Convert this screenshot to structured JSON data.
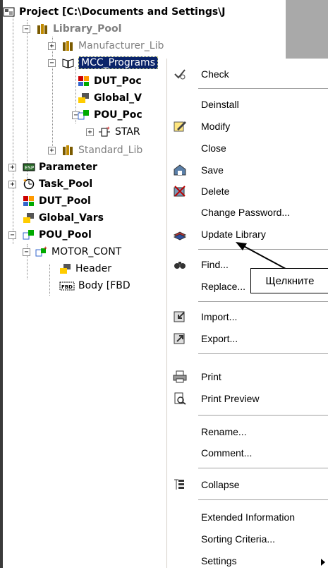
{
  "tree": {
    "project": "Project [C:\\Documents and Settings\\J",
    "library_pool": "Library_Pool",
    "manufacturer_lib": "Manufacturer_Lib",
    "mcc_programs": "MCC_Programs",
    "dut_pool_sub": "DUT_Poc",
    "global_vars_sub": "Global_V",
    "pou_pool_sub": "POU_Poc",
    "star_item": "STAR",
    "standard_lib": "Standard_Lib",
    "parameter": "Parameter",
    "task_pool": "Task_Pool",
    "dut_pool": "DUT_Pool",
    "global_vars": "Global_Vars",
    "pou_pool": "POU_Pool",
    "motor_cont": "MOTOR_CONT",
    "header": "Header",
    "body": "Body [FBD",
    "fbd_tag": "FBD"
  },
  "menu": {
    "check": "Check",
    "deinstall": "Deinstall",
    "modify": "Modify",
    "close": "Close",
    "save": "Save",
    "delete": "Delete",
    "change_password": "Change Password...",
    "update_library": "Update Library",
    "find": "Find...",
    "replace": "Replace...",
    "import": "Import...",
    "export": "Export...",
    "print": "Print",
    "print_preview": "Print Preview",
    "rename": "Rename...",
    "comment": "Comment...",
    "collapse": "Collapse",
    "extended_information": "Extended Information",
    "sorting_criteria": "Sorting Criteria...",
    "settings": "Settings"
  },
  "callout": {
    "text": "Щелкните"
  },
  "colors": {
    "selection": "#0a246a",
    "separator": "#a0a0a0",
    "frame": "#3a3a3a"
  }
}
